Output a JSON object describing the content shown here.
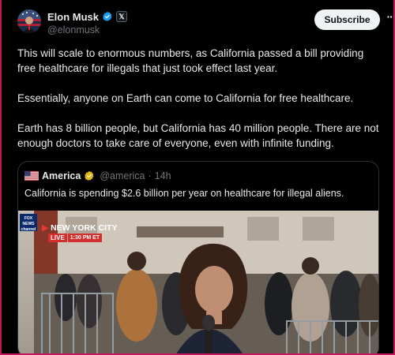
{
  "author": {
    "name": "Elon Musk",
    "handle": "@elonmusk",
    "x_badge": "𝕏",
    "verified_icon": "verified-badge-icon"
  },
  "actions": {
    "subscribe_label": "Subscribe",
    "more_label": "···"
  },
  "post": {
    "paragraphs": [
      "This will scale to enormous numbers, as California passed a bill providing free healthcare for illegals that just took effect last year.",
      "Essentially, anyone on Earth can come to California for free healthcare.",
      "Earth has 8 billion people, but California has 40 million people. There are not enough doctors to take care of everyone, even with infinite funding."
    ]
  },
  "quote": {
    "name": "America",
    "handle": "@america",
    "separator": "·",
    "time": "14h",
    "text": "California is spending $2.6 billion per year on healthcare for illegal aliens.",
    "media": {
      "network": "FOX NEWS channel",
      "location": "NEW YORK CITY",
      "live_label": "LIVE",
      "time_label": "1:30 PM ET"
    }
  },
  "colors": {
    "background": "#000000",
    "text": "#e7e9ea",
    "muted": "#71767b",
    "verified_blue": "#1d9bf0",
    "verified_gold": "#e2b719",
    "live_red": "#d32f2f"
  }
}
